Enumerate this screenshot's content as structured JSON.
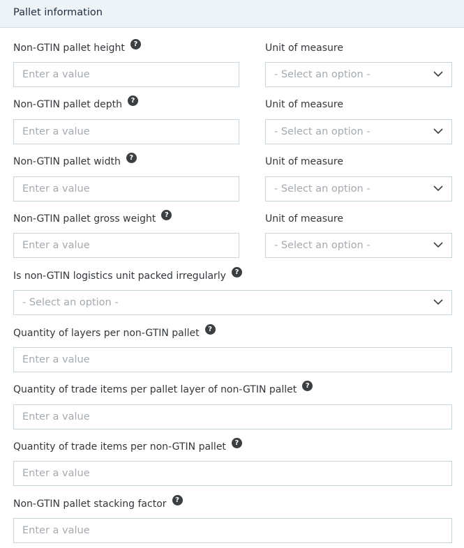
{
  "header": {
    "title": "Pallet information"
  },
  "placeholders": {
    "input": "Enter a value",
    "select": "- Select an option -"
  },
  "rows": [
    {
      "label": "Non-GTIN pallet height",
      "unit_label": "Unit of measure"
    },
    {
      "label": "Non-GTIN pallet depth",
      "unit_label": "Unit of measure"
    },
    {
      "label": "Non-GTIN pallet width",
      "unit_label": "Unit of measure"
    },
    {
      "label": "Non-GTIN pallet gross weight",
      "unit_label": "Unit of measure"
    }
  ],
  "fields": [
    {
      "label": "Is non-GTIN logistics unit packed irregularly",
      "type": "select"
    },
    {
      "label": "Quantity of layers per non-GTIN pallet",
      "type": "input"
    },
    {
      "label": "Quantity of trade items per pallet layer of non-GTIN pallet",
      "type": "input"
    },
    {
      "label": "Quantity of trade items per non-GTIN pallet",
      "type": "input"
    },
    {
      "label": "Non-GTIN pallet stacking factor",
      "type": "input"
    }
  ],
  "help_icon_glyph": "?"
}
